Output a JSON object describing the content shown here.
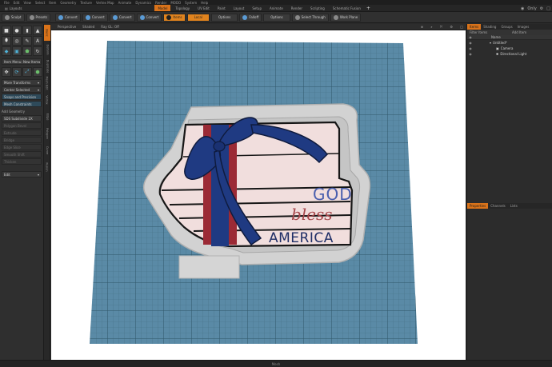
{
  "menubar": [
    "File",
    "Edit",
    "View",
    "Select",
    "Item",
    "Geometry",
    "Texture",
    "Vertex Map",
    "Animate",
    "Dynamics",
    "Render",
    "MODO",
    "System",
    "Help"
  ],
  "layout": {
    "switcher": "Layouts",
    "tabs": [
      "Model",
      "Topology",
      "UV Edit",
      "Paint",
      "Layout",
      "Setup",
      "Animate",
      "Render",
      "Scripting",
      "Schematic Fusion"
    ],
    "active_tab": "Model",
    "add_tab": "+",
    "only_label": "Only"
  },
  "toolbar": {
    "sculpt": "Sculpt",
    "presets": "Presets",
    "convert_buttons": [
      "Convert",
      "Convert",
      "Convert",
      "Convert"
    ],
    "items_label": "Items",
    "local_label": "Local",
    "options_label": "Options",
    "falloff_label": "Falloff",
    "options2_label": "Options",
    "select_through": "Select Through",
    "work_plane": "Work Plane"
  },
  "left_panel": {
    "tool_icons": [
      "cube",
      "sphere",
      "cylinder",
      "cone",
      "capsule",
      "torus",
      "pen",
      "text",
      "bevel",
      "extrude",
      "shield",
      "loop"
    ],
    "item_menu": "Item Menu: New Item",
    "more_transforms": "More Transforms",
    "center_selected": "Center Selected",
    "snaps": "Snaps and Precision",
    "mesh_constraints": "Mesh Constraints",
    "add_geometry": "Add Geometry",
    "sds_subdivide": "SDS Subdivide 2X",
    "disabled_items": [
      "Polygon Bevel",
      "Extrude",
      "Bridge",
      "Edge Slice",
      "Smooth Shift",
      "Thicken"
    ],
    "edit_label": "Edit",
    "vertical_tabs": [
      "Basic",
      "Deform",
      "Duplicate",
      "Mesh Edit",
      "Vertex",
      "Edge",
      "Polygon",
      "Curve",
      "Fusion"
    ]
  },
  "viewport": {
    "header": [
      "Perspective",
      "Shaded",
      "Ray GL: Off"
    ],
    "ornament_lines": [
      "GOD",
      "bless",
      "AMERICA"
    ]
  },
  "right_panel": {
    "tabs_top": [
      "Items",
      "Shading",
      "Groups",
      "Images"
    ],
    "filter_label": "Filter Items",
    "add_item": "Add Item",
    "column_name": "Name",
    "scene_items": [
      "Untitled*",
      "Camera",
      "Directional Light"
    ],
    "tabs_bottom": [
      "Properties",
      "Channels",
      "Lists"
    ]
  },
  "status": {
    "center": "Mesh"
  },
  "colors": {
    "accent": "#d9731a",
    "grid_bg": "#5a8aa6",
    "book": "#f1dedd",
    "stripe": "#9b2a35",
    "ribbon": "#1f3a82",
    "god": "#4a5fae",
    "bless": "#a6474b",
    "america": "#1f2e66"
  }
}
